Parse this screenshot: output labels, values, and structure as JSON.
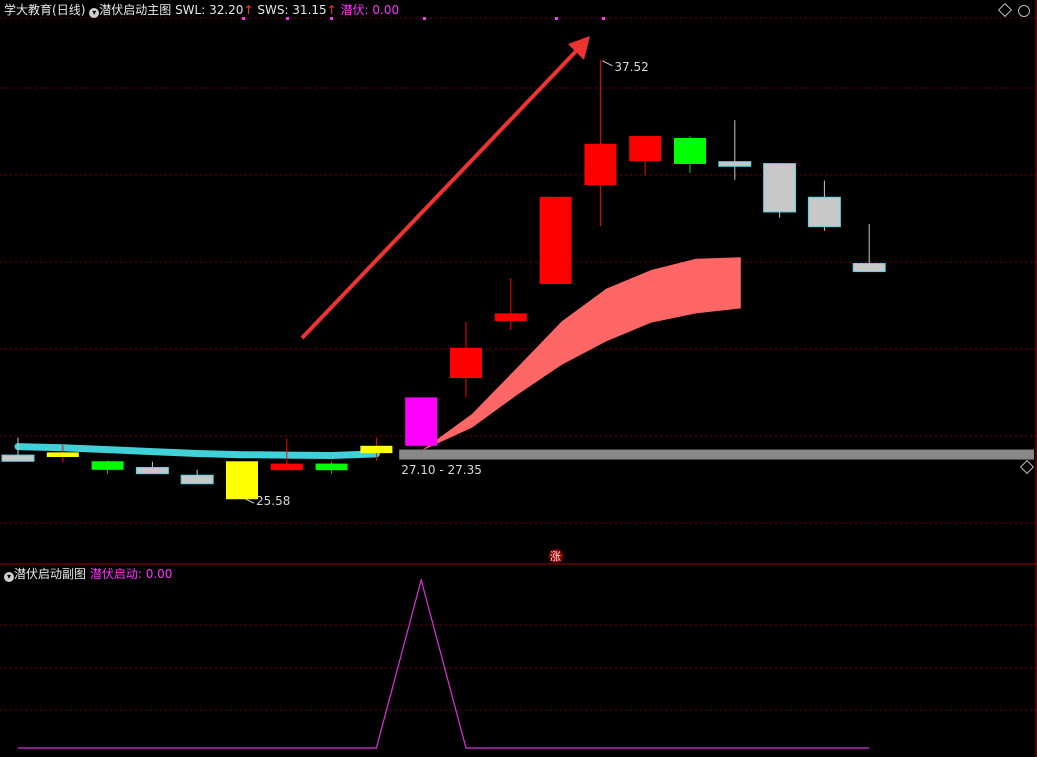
{
  "main_header": {
    "stock_name": "学大教育",
    "period": "(日线)",
    "indicator": "潜伏启动主图",
    "swl_label": "SWL: 32.20",
    "sws_label": "SWS: 31.15",
    "qianfu_label": "潜伏: 0.00",
    "up_arrow": "↑"
  },
  "sub_header": {
    "indicator": "潜伏启动副图",
    "value_label": "潜伏启动: 0.00"
  },
  "annotations": {
    "high_label": "37.52",
    "low_label": "25.58",
    "range_label": "27.10 - 27.35",
    "zhang_badge": "涨"
  },
  "colors": {
    "background": "#000000",
    "grid": "#7a0000",
    "up_candle": "#ff0000",
    "down_candle": "#00ff00",
    "doji_candle": "#c8c8c8",
    "yellow_candle": "#ffff00",
    "signal_candle": "#ff00ff",
    "ma_line": "#40d0d8",
    "band_fill": "#ff6666",
    "support_bar": "#888888",
    "arrow": "#ee3333",
    "sub_line": "#e030e0"
  },
  "chart_data": [
    {
      "type": "candlestick",
      "title": "潜伏启动主图",
      "ylim": [
        24.6,
        38.6
      ],
      "candles": [
        {
          "open": 27.31,
          "high": 27.76,
          "close": 27.15,
          "low": 27.15,
          "color": "gray"
        },
        {
          "open": 27.38,
          "high": 27.57,
          "close": 27.26,
          "low": 27.12,
          "color": "yellow"
        },
        {
          "open": 27.15,
          "high": 27.17,
          "close": 26.93,
          "low": 26.82,
          "color": "green"
        },
        {
          "open": 26.99,
          "high": 27.14,
          "close": 26.83,
          "low": 26.83,
          "color": "gray"
        },
        {
          "open": 26.79,
          "high": 26.93,
          "close": 26.57,
          "low": 26.57,
          "color": "gray"
        },
        {
          "open": 26.17,
          "high": 27.15,
          "close": 27.15,
          "low": 26.17,
          "color": "yellow"
        },
        {
          "open": 26.92,
          "high": 27.74,
          "close": 27.09,
          "low": 26.92,
          "color": "red"
        },
        {
          "open": 27.09,
          "high": 27.14,
          "close": 26.92,
          "low": 26.82,
          "color": "green"
        },
        {
          "open": 27.36,
          "high": 27.76,
          "close": 27.55,
          "low": 27.16,
          "color": "yellow"
        },
        {
          "open": 27.55,
          "high": 28.8,
          "close": 28.8,
          "low": 27.55,
          "color": "magenta"
        },
        {
          "open": 29.3,
          "high": 30.76,
          "close": 30.08,
          "low": 28.8,
          "color": "red"
        },
        {
          "open": 30.77,
          "high": 31.88,
          "close": 30.97,
          "low": 30.54,
          "color": "red"
        },
        {
          "open": 31.73,
          "high": 33.98,
          "close": 33.98,
          "low": 31.73,
          "color": "red"
        },
        {
          "open": 34.28,
          "high": 37.52,
          "close": 35.35,
          "low": 33.22,
          "color": "red"
        },
        {
          "open": 34.9,
          "high": 35.38,
          "close": 35.55,
          "low": 34.54,
          "color": "red"
        },
        {
          "open": 35.5,
          "high": 35.55,
          "close": 34.83,
          "low": 34.6,
          "color": "green"
        },
        {
          "open": 34.89,
          "high": 35.96,
          "close": 34.77,
          "low": 34.42,
          "color": "gray"
        },
        {
          "open": 34.84,
          "high": 34.84,
          "close": 33.59,
          "low": 33.44,
          "color": "gray"
        },
        {
          "open": 33.97,
          "high": 34.4,
          "close": 33.21,
          "low": 33.1,
          "color": "gray"
        },
        {
          "open": 32.26,
          "high": 33.28,
          "close": 32.05,
          "low": 32.05,
          "color": "gray"
        }
      ],
      "ma_line": [
        27.53,
        27.5,
        27.45,
        27.4,
        27.35,
        27.32,
        27.31,
        27.3,
        27.34
      ],
      "band": {
        "upper": [
          27.42,
          28.37,
          29.56,
          30.76,
          31.61,
          32.09,
          32.38,
          32.42
        ],
        "lower": [
          27.42,
          28.02,
          28.86,
          29.64,
          30.25,
          30.73,
          30.97,
          31.1
        ]
      },
      "support_level": [
        27.1,
        27.35
      ]
    },
    {
      "type": "line",
      "title": "潜伏启动副图",
      "values": [
        0,
        0,
        0,
        0,
        0,
        0,
        0,
        0,
        0,
        1,
        0,
        0,
        0,
        0,
        0,
        0,
        0,
        0,
        0,
        0
      ],
      "ylim": [
        0,
        1.0
      ]
    }
  ]
}
